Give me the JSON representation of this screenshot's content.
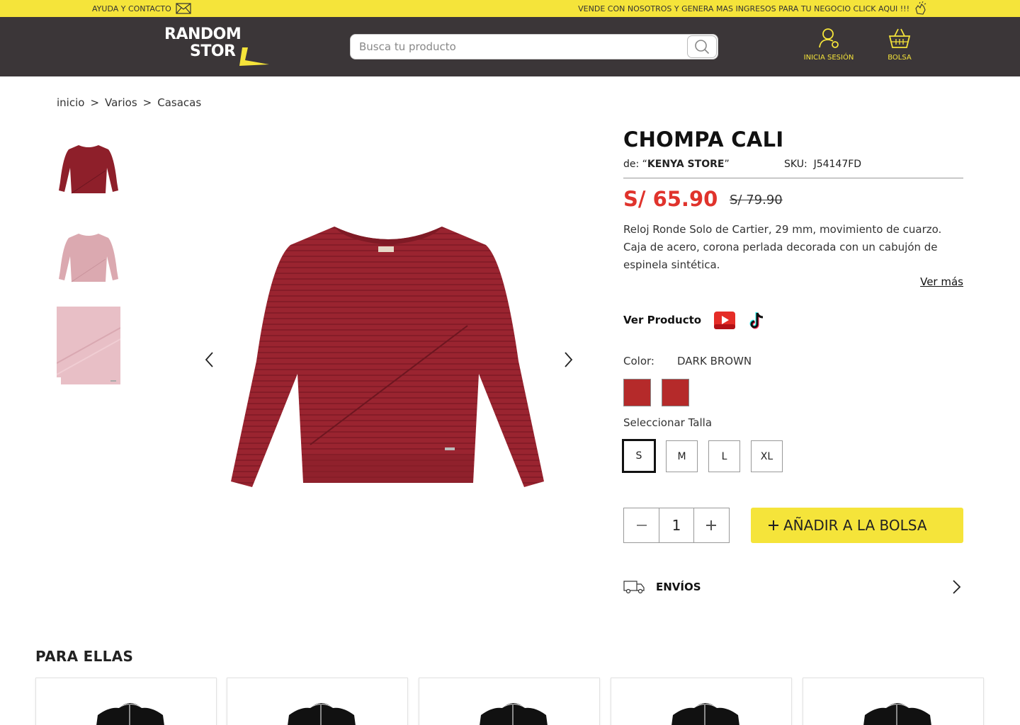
{
  "topbar": {
    "help_text": "AYUDA Y CONTACTO",
    "sell_text": "VENDE CON NOSOTROS Y  GENERA MAS INGRESOS PARA TU NEGOCIO CLICK AQUI !!!"
  },
  "header": {
    "logo_line1": "RANDOM",
    "logo_line2": "STOR",
    "search_placeholder": "Busca tu producto",
    "login_label": "INICIA SESIÓN",
    "bag_label": "BOLSA"
  },
  "breadcrumb": [
    "inicio",
    ">",
    "Varios",
    ">",
    "Casacas"
  ],
  "product": {
    "title": "CHOMPA CALI",
    "vendor_prefix": "de: “",
    "vendor_name": "KENYA STORE",
    "vendor_suffix": "”",
    "sku_label": "SKU:",
    "sku_value": "J54147FD",
    "price": "S/ 65.90",
    "old_price": "S/ 79.90",
    "description": "Reloj Ronde Solo de Cartier, 29 mm, movimiento de cuarzo. Caja de acero, corona perlada decorada con un cabujón de espinela sintética.",
    "ver_mas": "Ver más",
    "ver_producto": "Ver Producto",
    "color_label": "Color:",
    "color_value": "DARK BROWN",
    "talla_label": "Seleccionar Talla",
    "sizes": [
      "S",
      "M",
      "L",
      "XL"
    ],
    "selected_size": "S",
    "quantity": "1",
    "add_label": "AÑADIR A LA BOLSA",
    "envios_label": "ENVÍOS"
  },
  "section": {
    "title": "PARA ELLAS"
  },
  "colors": {
    "accent": "#f5e43a",
    "header_bg": "#3b3638",
    "price": "#e0332c",
    "swatch": "#b52a2a"
  }
}
